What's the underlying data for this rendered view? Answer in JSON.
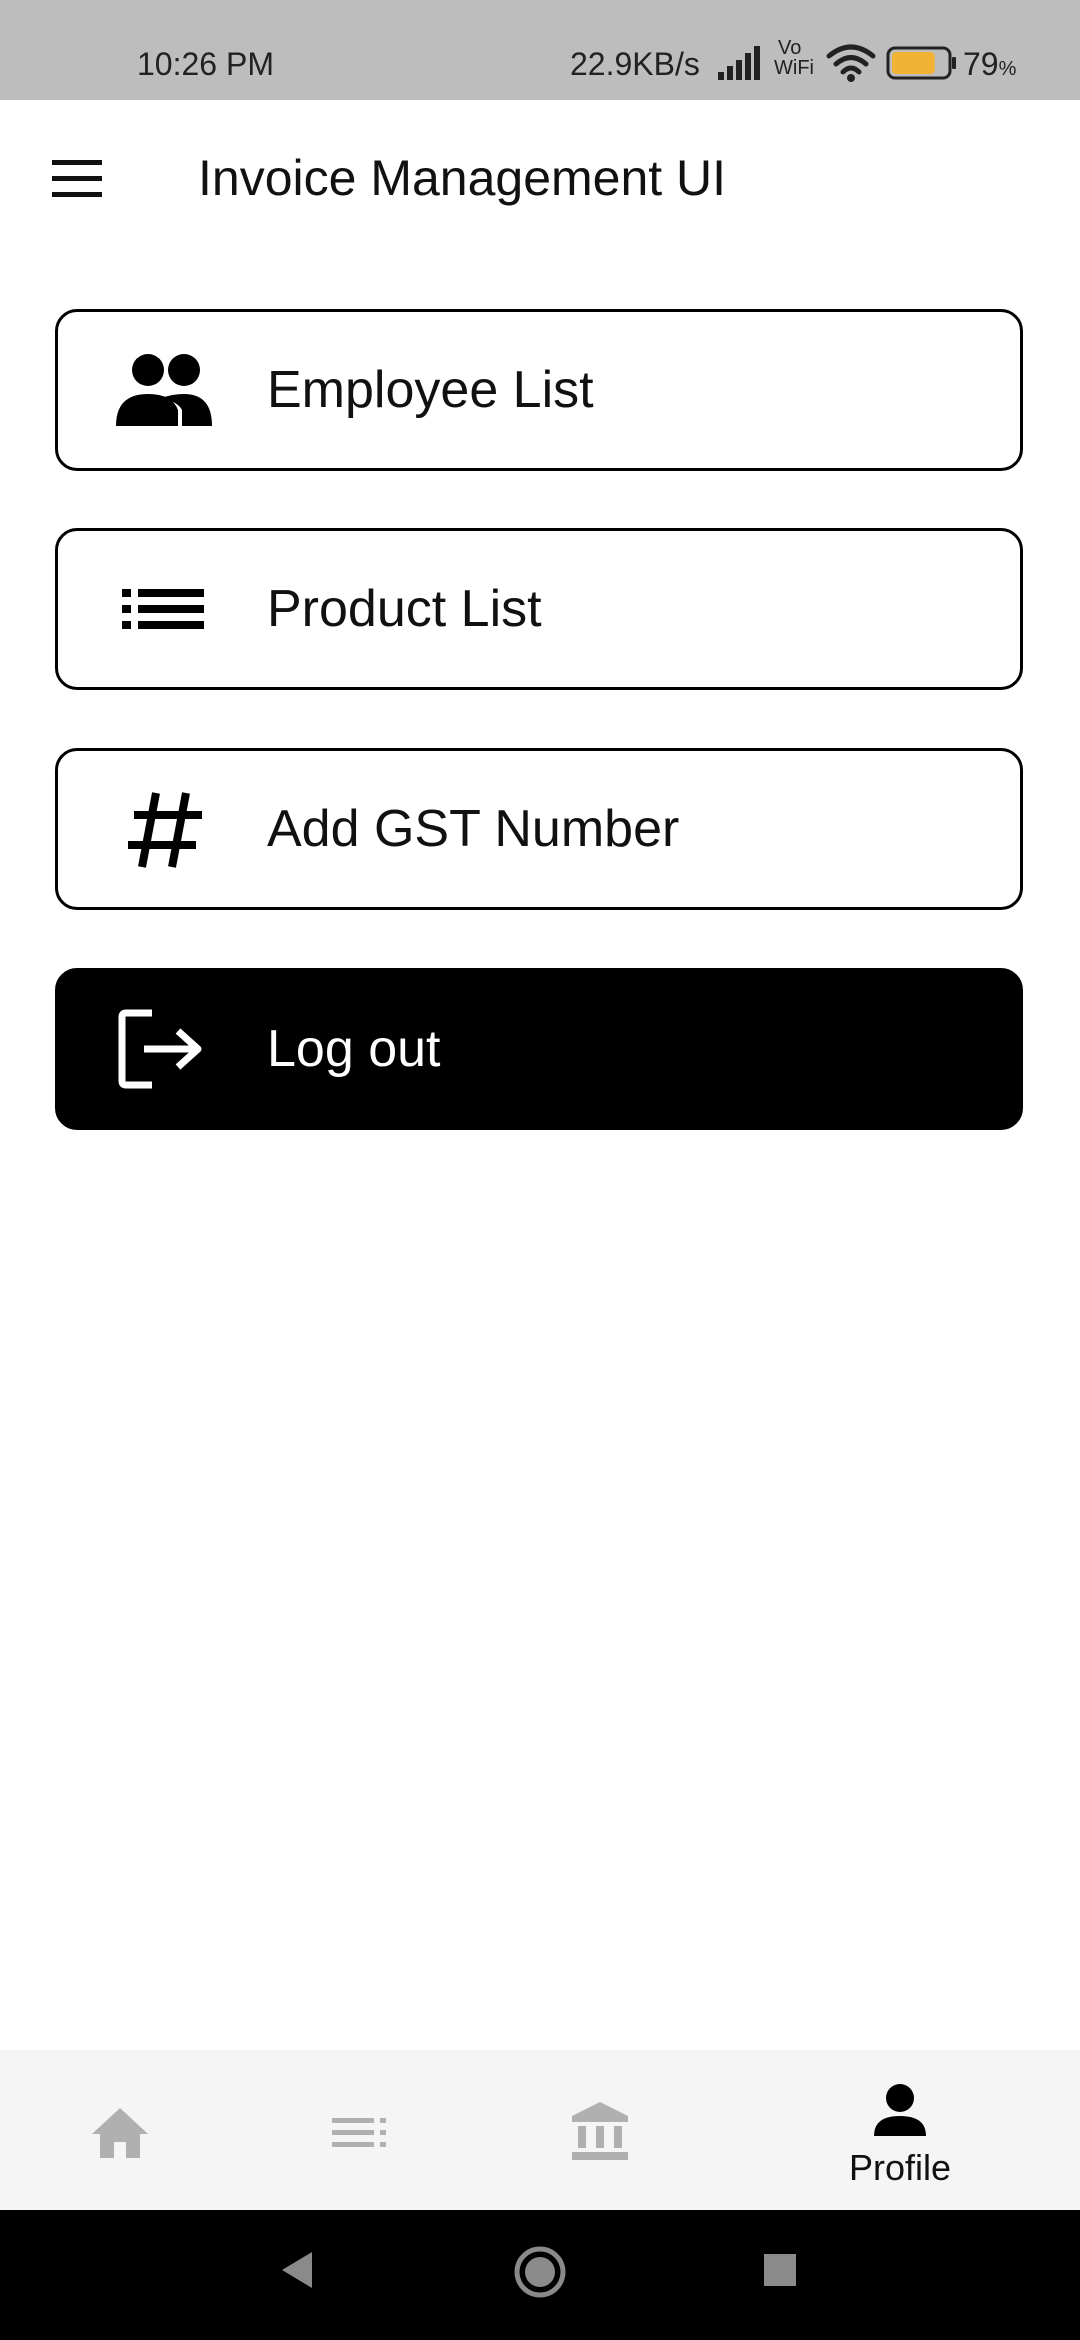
{
  "status_bar": {
    "time": "10:26 PM",
    "network_speed": "22.9KB/s",
    "vowifi_top": "Vo",
    "vowifi_bottom": "WiFi",
    "battery_level": "79",
    "battery_unit": "%",
    "battery_fill_fraction": 0.79,
    "battery_color": "#f2b233"
  },
  "app_bar": {
    "title": "Invoice Management UI",
    "menu_icon": "hamburger-menu-icon"
  },
  "menu_items": [
    {
      "label": "Employee List",
      "icon": "people-icon"
    },
    {
      "label": "Product List",
      "icon": "list-icon"
    },
    {
      "label": "Add GST Number",
      "icon": "hash-icon"
    },
    {
      "label": "Log out",
      "icon": "logout-icon"
    }
  ],
  "bottom_nav": {
    "items": [
      {
        "icon": "home-icon",
        "label": ""
      },
      {
        "icon": "list-icon",
        "label": ""
      },
      {
        "icon": "bank-icon",
        "label": ""
      },
      {
        "icon": "person-icon",
        "label": "Profile",
        "active": true
      }
    ],
    "inactive_color": "#b0b0b0",
    "active_color": "#000000"
  },
  "system_nav": {
    "buttons": [
      "back-icon",
      "home-circle-icon",
      "recents-square-icon"
    ]
  }
}
